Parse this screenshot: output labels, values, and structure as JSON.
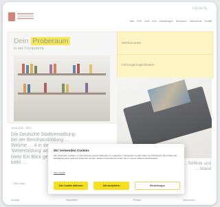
{
  "header": {
    "lang": "f | Q | en | 🔍",
    "nav": [
      "Start",
      "RSS",
      "Links",
      "Kino",
      "Ausstellungen",
      "Impressum",
      "Datenschutz",
      "Kontakt"
    ]
  },
  "hero": {
    "title_1": "Dein",
    "title_highlight": "Proberaum",
    "subtitle": "in der Computeria",
    "links": [
      {
        "arrow": "→",
        "label": "Mietformulare"
      },
      {
        "arrow": "→",
        "label": "Führungsmöglichkeiten"
      }
    ]
  },
  "news": {
    "date": "15.08.2023 · 2023",
    "title": "Die Deutsche Stadtverwaltung bei der Berufsausbildung … Welche … 4 in die 'Weiterbildung' an der Zeit? … Mehr Ein Blick gesucht … jetzt kelhl …",
    "cta": "→ Mehr lesen",
    "right_text": "… Softkite und … Wand"
  },
  "footer": [
    "Kontakt",
    "Newsletter",
    "Presse",
    "Impressum"
  ],
  "cookie": {
    "title": "Wir verwenden Cookies",
    "text": "Wir verwenden Cookies, um die Nutzung unserer Webseiten zu analysieren. Ausserdem werden Daten an Drittanbieter übermittelt. Die Einwilligung kann jederzeit widerrufen werden. Weitere Informationen finden Sie in unseren Datenschutzhinweisen.",
    "link": "Mehr Details",
    "reject": "Alle Cookies ablehnen",
    "accept": "Alle akzeptieren",
    "settings": "Einstellungen"
  },
  "colors": {
    "accent_yellow": "#f6e01f",
    "hero_text": "#9aa27e",
    "logo": "#c66b5d"
  }
}
